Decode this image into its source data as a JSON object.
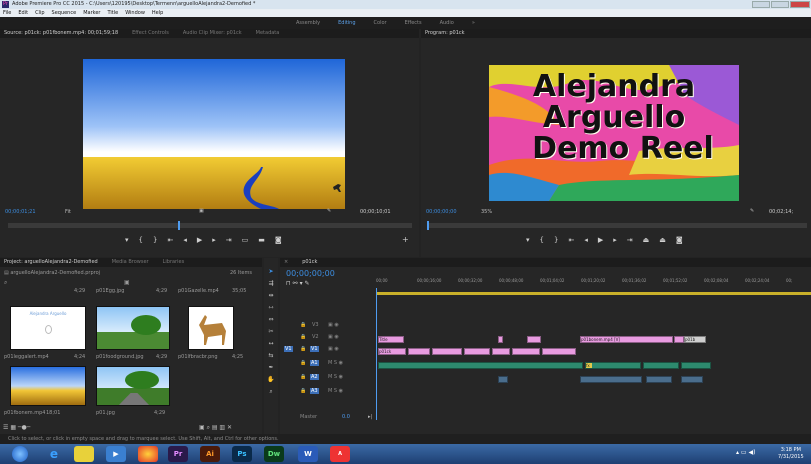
{
  "window": {
    "title": "Adobe Premiere Pro CC 2015 - C:\\Users\\120195\\Desktop\\Termenn\\arguelloAlejandra2-Demofied *"
  },
  "menu": [
    "File",
    "Edit",
    "Clip",
    "Sequence",
    "Marker",
    "Title",
    "Window",
    "Help"
  ],
  "workspaces": [
    "Assembly",
    "Editing",
    "Color",
    "Effects",
    "Audio"
  ],
  "source": {
    "tabs": [
      "Source: p01ck: p01fbonem.mp4: 00;01;59;18",
      "Effect Controls",
      "Audio Clip Mixer: p01ck",
      "Metadata"
    ],
    "timecode_in": "00;00;01;21",
    "fit": "Fit",
    "timecode_dur": "00;00;10;01"
  },
  "program": {
    "tabs": [
      "Program: p01ck"
    ],
    "timecode_in": "00;00;00;00",
    "zoom": "35%",
    "timecode_dur": "00;02;14;",
    "reel_title": [
      "Alejandra",
      "Arguello",
      "Demo Reel"
    ]
  },
  "project": {
    "tabs": [
      "Project: arguelloAlejandra2-Demofied",
      "Media Browser",
      "Libraries"
    ],
    "file": "arguelloAlejandra2-Demofied.prproj",
    "count": "26 Items",
    "items": [
      {
        "name": "",
        "dur": "4;29"
      },
      {
        "name": "p01Egg.jpg",
        "dur": "4;29"
      },
      {
        "name": "p01Gazelle.mp4",
        "dur": "35;05"
      },
      {
        "name": "p01leggalert.mp4",
        "dur": "4;24"
      },
      {
        "name": "p01foodground.jpg",
        "dur": "4;29"
      },
      {
        "name": "p01lfbracbr.png",
        "dur": "4;25"
      },
      {
        "name": "p01fbonem.mp4",
        "dur": "18;01"
      },
      {
        "name": "p01.jpg",
        "dur": "4;29"
      }
    ]
  },
  "timeline": {
    "tab": "p01ck",
    "timecode": "00;00;00;00",
    "ruler": [
      "00;00",
      "00;00;16;00",
      "00;00;32;00",
      "00;00;48;00",
      "00;01;04;02",
      "00;01;20;02",
      "00;01;36;02",
      "00;01;52;02",
      "00;02;08;04",
      "00;02;24;04",
      "00;"
    ],
    "tracks": [
      "V3",
      "V2",
      "V1",
      "A1",
      "A2",
      "A3",
      "Master"
    ],
    "master_val": "0.0",
    "clips": {
      "title": "Title",
      "v1a": "p01ck",
      "v2b": "p01bonem.mp4 [V]",
      "v2c": "p01b",
      "fx": "fx"
    }
  },
  "status": "Click to select, or click in empty space and drag to marquee select. Use Shift, Alt, and Ctrl for other options.",
  "taskbar": {
    "clock_time": "3:18 PM",
    "clock_date": "7/31/2015",
    "apps": [
      "Pr",
      "Ai",
      "Ps",
      "Dw",
      "W",
      "Acrobat"
    ]
  }
}
